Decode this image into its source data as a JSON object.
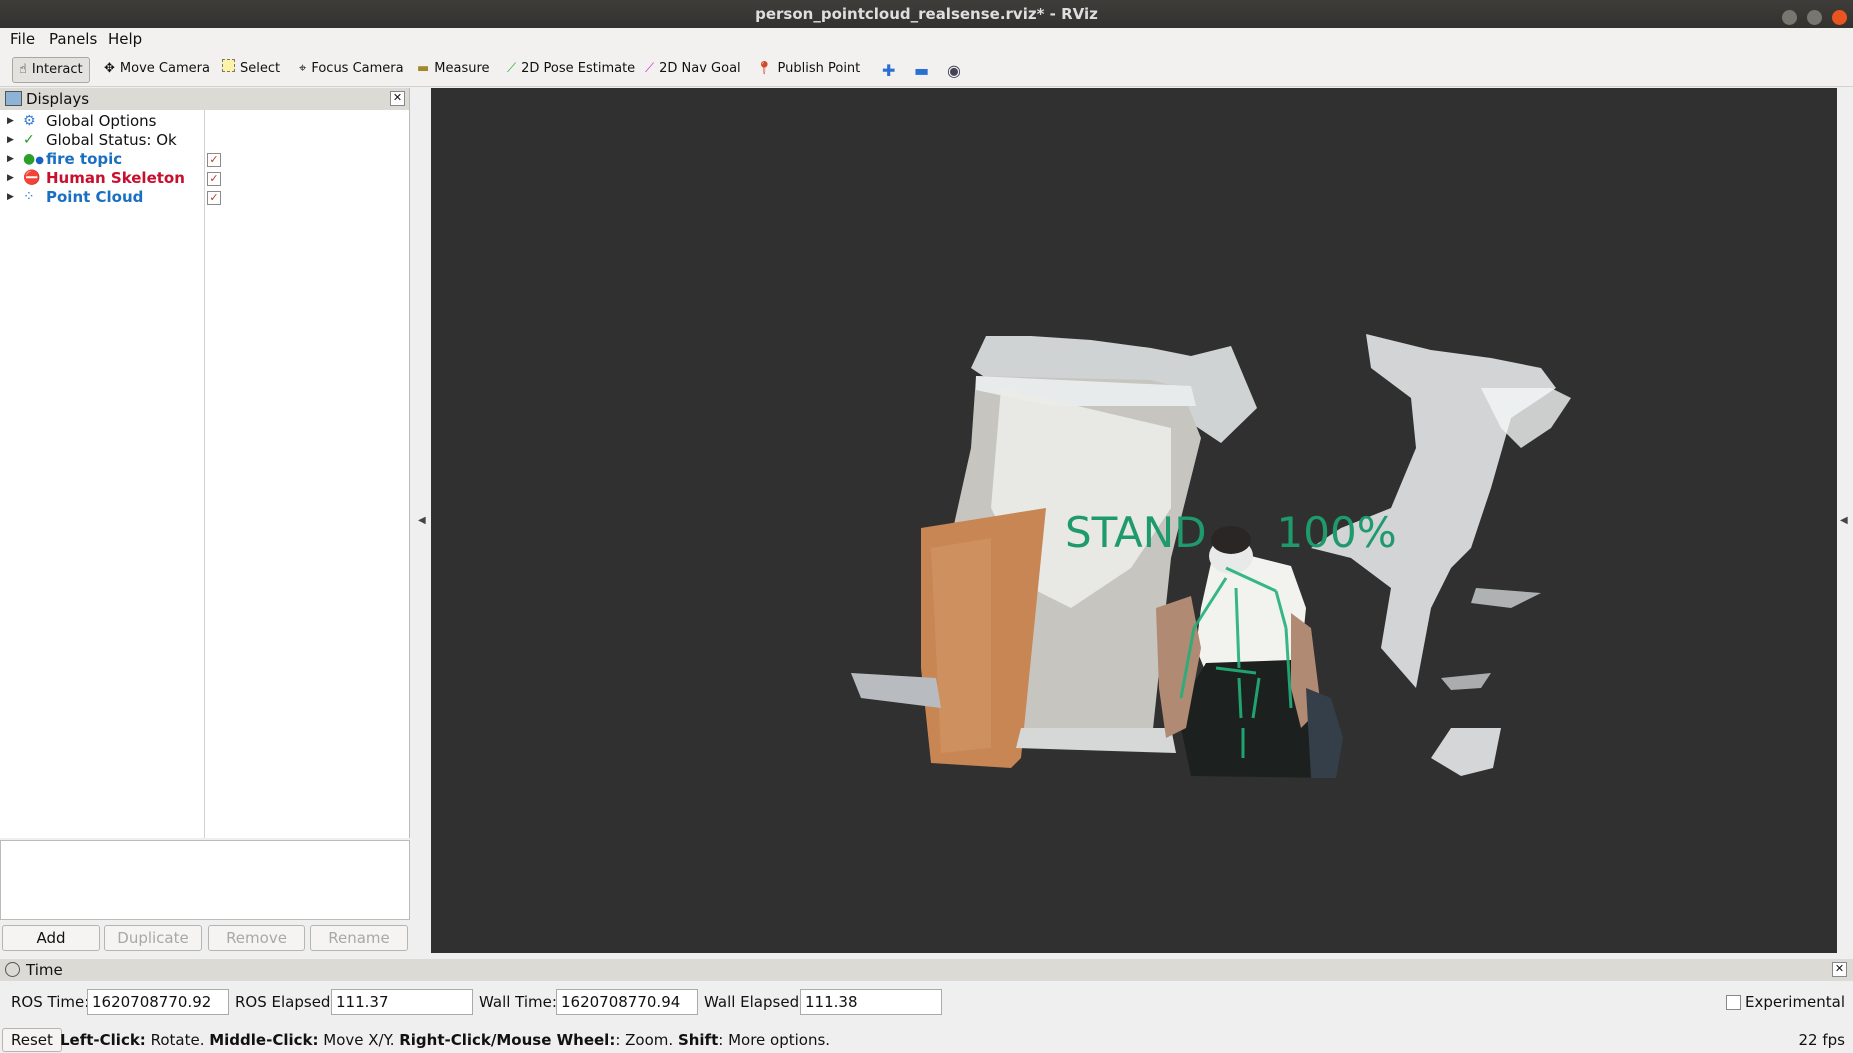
{
  "window": {
    "title": "person_pointcloud_realsense.rviz* - RViz"
  },
  "menu": {
    "file": "File",
    "panels": "Panels",
    "help": "Help"
  },
  "toolbar": {
    "interact": "Interact",
    "move_camera": "Move Camera",
    "select": "Select",
    "focus_camera": "Focus Camera",
    "measure": "Measure",
    "pose_estimate": "2D Pose Estimate",
    "nav_goal": "2D Nav Goal",
    "publish_point": "Publish Point"
  },
  "displays": {
    "title": "Displays",
    "items": [
      {
        "label": "Global Options",
        "icon": "gear-icon",
        "checkbox": false
      },
      {
        "label": "Global Status: Ok",
        "icon": "check-icon",
        "checkbox": false
      },
      {
        "label": "fire topic",
        "icon": "marker-icon",
        "checkbox": true,
        "checked": true
      },
      {
        "label": "Human Skeleton",
        "icon": "error-icon",
        "checkbox": true,
        "checked": true
      },
      {
        "label": "Point Cloud",
        "icon": "pointcloud-icon",
        "checkbox": true,
        "checked": true
      }
    ],
    "buttons": {
      "add": "Add",
      "duplicate": "Duplicate",
      "remove": "Remove",
      "rename": "Rename"
    }
  },
  "viewport": {
    "overlay_label": "STAND",
    "overlay_percent": "100%"
  },
  "time": {
    "title": "Time",
    "ros_time_label": "ROS Time:",
    "ros_time": "1620708770.92",
    "ros_elapsed_label": "ROS Elapsed:",
    "ros_elapsed": "111.37",
    "wall_time_label": "Wall Time:",
    "wall_time": "1620708770.94",
    "wall_elapsed_label": "Wall Elapsed:",
    "wall_elapsed": "111.38",
    "experimental": "Experimental"
  },
  "status": {
    "reset": "Reset",
    "left_click": "Left-Click:",
    "left_click_desc": " Rotate. ",
    "middle_click": "Middle-Click:",
    "middle_click_desc": " Move X/Y. ",
    "right_click": "Right-Click/Mouse Wheel:",
    "right_click_desc": ": Zoom. ",
    "shift": "Shift",
    "shift_desc": ": More options.",
    "fps": "22 fps"
  },
  "colors": {
    "accent": "#e95420",
    "viewport_bg": "#303030",
    "overlay": "#1e9a6c"
  }
}
